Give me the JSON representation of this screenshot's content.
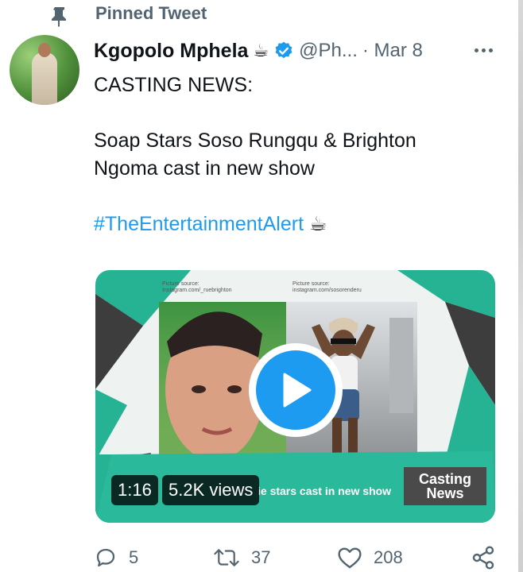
{
  "tweet": {
    "pinned_label": "Pinned Tweet",
    "author": {
      "display_name": "Kgopolo Mphela",
      "emoji": "☕",
      "handle": "@Ph...",
      "date": "· Mar 8"
    },
    "lines": [
      "CASTING NEWS:",
      "",
      "Soap Stars Soso Rungqu & Brighton",
      "Ngoma cast in new show",
      ""
    ],
    "hashtag": "#TheEntertainmentAlert",
    "hashtag_emoji": "☕",
    "video": {
      "duration": "1:16",
      "views": "5.2K views",
      "banner_text": "ie stars cast in new show",
      "brand_line1": "Casting",
      "brand_line2": "News",
      "source_left_1": "Picture source:",
      "source_left_2": "Instagram.com/_ruebrighton",
      "source_right_1": "Picture source:",
      "source_right_2": "instagram.com/sosorenderu"
    },
    "actions": {
      "replies": "5",
      "retweets": "37",
      "likes": "208"
    }
  },
  "colors": {
    "accent": "#1d9bf0",
    "secondary_text": "#536471",
    "teal": "#26b394"
  }
}
